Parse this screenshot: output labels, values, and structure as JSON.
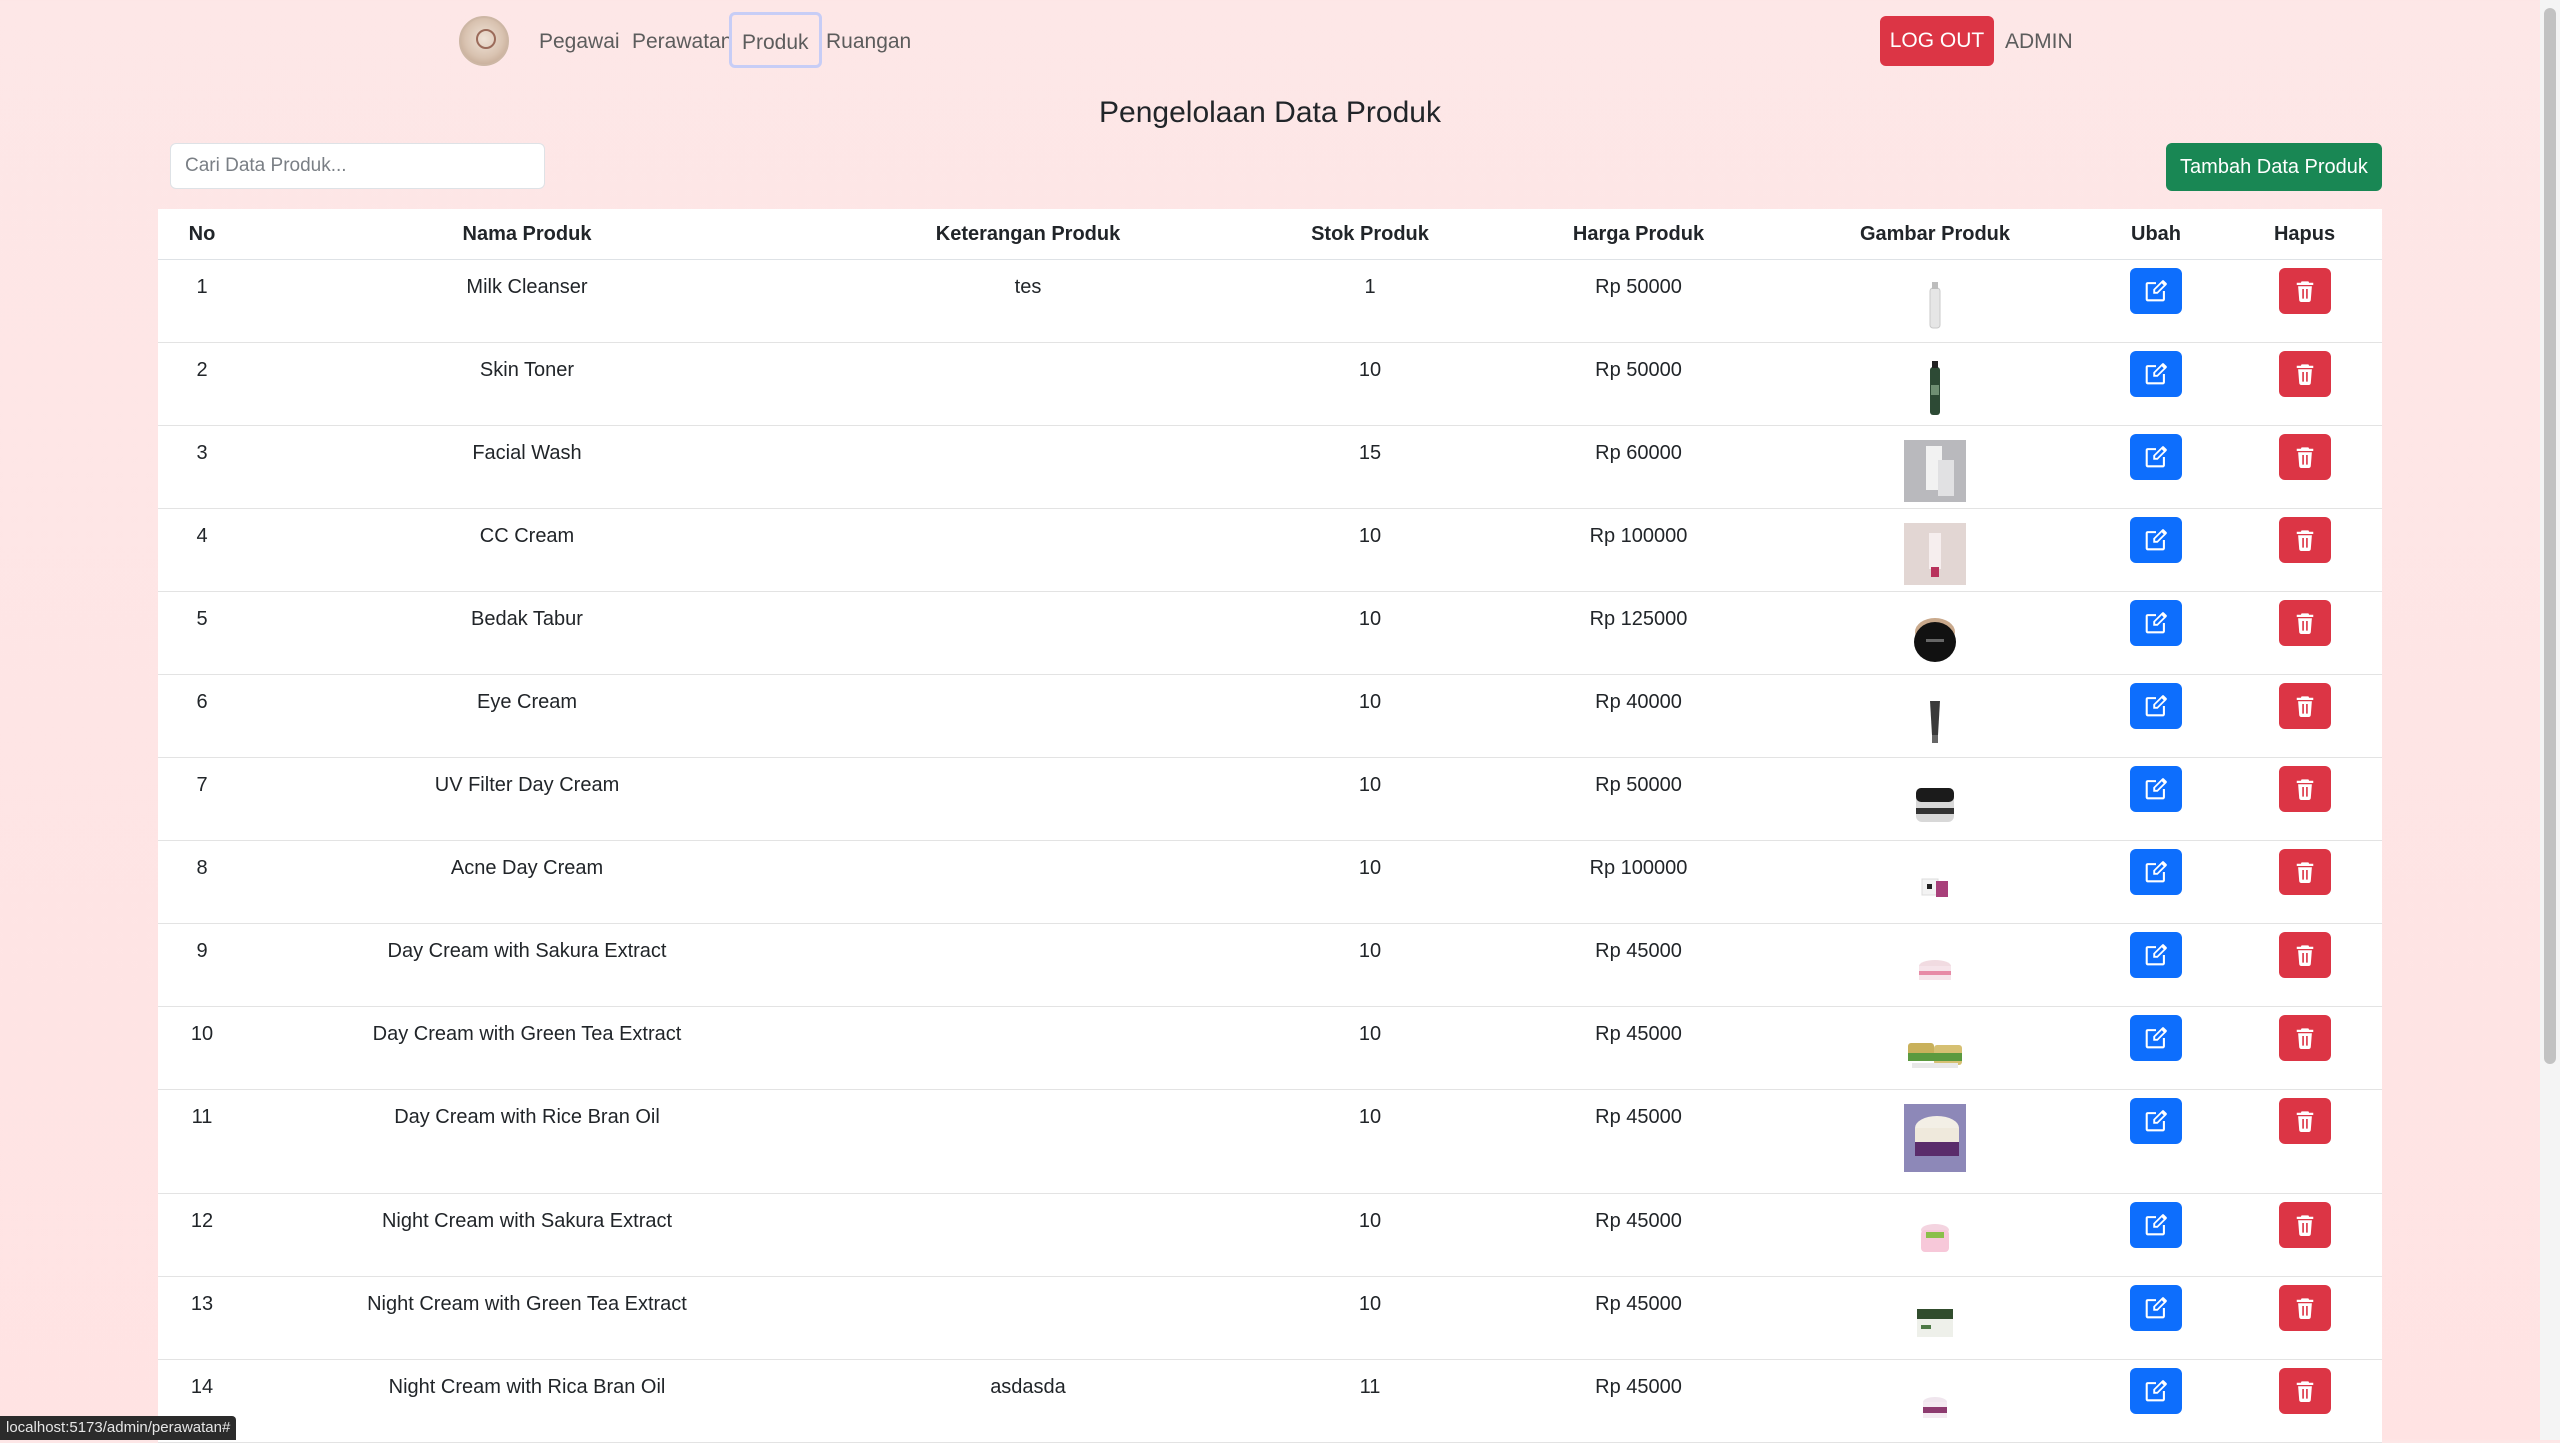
{
  "nav": {
    "links": [
      "Pegawai",
      "Perawatan",
      "Produk",
      "Ruangan"
    ],
    "active": "Produk",
    "logout_label": "LOG OUT",
    "admin_label": "ADMIN"
  },
  "page": {
    "title": "Pengelolaan Data Produk",
    "search_placeholder": "Cari Data Produk...",
    "add_label": "Tambah Data Produk"
  },
  "table": {
    "headers": [
      "No",
      "Nama Produk",
      "Keterangan Produk",
      "Stok Produk",
      "Harga Produk",
      "Gambar Produk",
      "Ubah",
      "Hapus"
    ],
    "rows": [
      {
        "no": "1",
        "nama": "Milk Cleanser",
        "keterangan": "tes",
        "stok": "1",
        "harga": "Rp 50000",
        "img": "white-bottle"
      },
      {
        "no": "2",
        "nama": "Skin Toner",
        "keterangan": "",
        "stok": "10",
        "harga": "Rp 50000",
        "img": "green-bottle"
      },
      {
        "no": "3",
        "nama": "Facial Wash",
        "keterangan": "",
        "stok": "15",
        "harga": "Rp 60000",
        "img": "grey-tube"
      },
      {
        "no": "4",
        "nama": "CC Cream",
        "keterangan": "",
        "stok": "10",
        "harga": "Rp 100000",
        "img": "pink-tube"
      },
      {
        "no": "5",
        "nama": "Bedak Tabur",
        "keterangan": "",
        "stok": "10",
        "harga": "Rp 125000",
        "img": "black-compact"
      },
      {
        "no": "6",
        "nama": "Eye Cream",
        "keterangan": "",
        "stok": "10",
        "harga": "Rp 40000",
        "img": "dark-tube"
      },
      {
        "no": "7",
        "nama": "UV Filter Day Cream",
        "keterangan": "",
        "stok": "10",
        "harga": "Rp 50000",
        "img": "black-jar"
      },
      {
        "no": "8",
        "nama": "Acne Day Cream",
        "keterangan": "",
        "stok": "10",
        "harga": "Rp 100000",
        "img": "purple-jar"
      },
      {
        "no": "9",
        "nama": "Day Cream with Sakura Extract",
        "keterangan": "",
        "stok": "10",
        "harga": "Rp 45000",
        "img": "pink-jar"
      },
      {
        "no": "10",
        "nama": "Day Cream with Green Tea Extract",
        "keterangan": "",
        "stok": "10",
        "harga": "Rp 45000",
        "img": "green-jars"
      },
      {
        "no": "11",
        "nama": "Day Cream with Rice Bran Oil",
        "keterangan": "",
        "stok": "10",
        "harga": "Rp 45000",
        "img": "purple-jar-large"
      },
      {
        "no": "12",
        "nama": "Night Cream with Sakura Extract",
        "keterangan": "",
        "stok": "10",
        "harga": "Rp 45000",
        "img": "pink-jar-2"
      },
      {
        "no": "13",
        "nama": "Night Cream with Green Tea Extract",
        "keterangan": "",
        "stok": "10",
        "harga": "Rp 45000",
        "img": "green-jar-2"
      },
      {
        "no": "14",
        "nama": "Night Cream with Rica Bran Oil",
        "keterangan": "asdasda",
        "stok": "11",
        "harga": "Rp 45000",
        "img": "purple-jar-2"
      }
    ]
  },
  "status_url": "localhost:5173/admin/perawatan#",
  "colors": {
    "primary": "#0d6efd",
    "danger": "#dc3545",
    "success": "#198754"
  }
}
